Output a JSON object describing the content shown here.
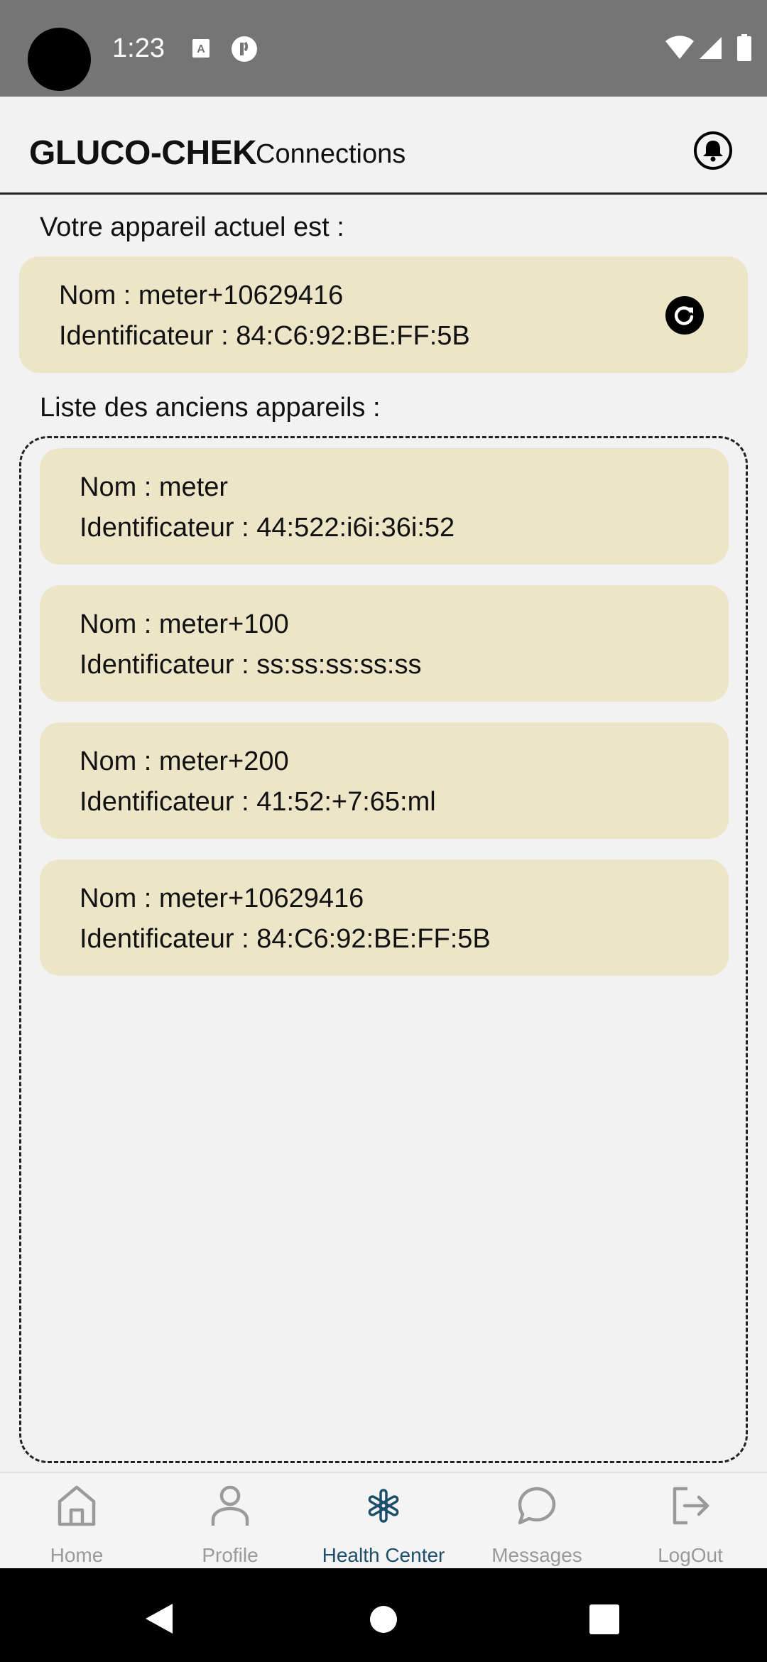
{
  "status_bar": {
    "time": "1:23"
  },
  "header": {
    "brand": "GLUCO-CHEK",
    "subtitle": "Connections"
  },
  "current_device": {
    "label": "Votre appareil actuel est :",
    "name_line": "Nom : meter+10629416",
    "id_line": "Identificateur : 84:C6:92:BE:FF:5B"
  },
  "history": {
    "label": "Liste des anciens appareils :",
    "devices": [
      {
        "name_line": "Nom : meter",
        "id_line": "Identificateur : 44:522:i6i:36i:52"
      },
      {
        "name_line": "Nom : meter+100",
        "id_line": "Identificateur : ss:ss:ss:ss:ss"
      },
      {
        "name_line": "Nom : meter+200",
        "id_line": "Identificateur : 41:52:+7:65:ml"
      },
      {
        "name_line": "Nom : meter+10629416",
        "id_line": "Identificateur : 84:C6:92:BE:FF:5B"
      }
    ]
  },
  "bottom_nav": {
    "active": "Health Center",
    "active_color": "#1d4f6b",
    "items": [
      {
        "label": "Home",
        "icon": "home-icon"
      },
      {
        "label": "Profile",
        "icon": "person-icon"
      },
      {
        "label": "Health Center",
        "icon": "asterisk-icon"
      },
      {
        "label": "Messages",
        "icon": "chat-bubble-icon"
      },
      {
        "label": "LogOut",
        "icon": "logout-icon"
      }
    ]
  },
  "colors": {
    "card_background": "#ede5c7",
    "status_bar": "#757575"
  }
}
